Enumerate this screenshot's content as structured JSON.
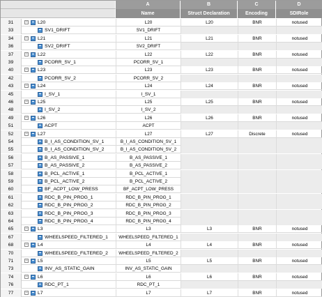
{
  "columns": {
    "letters": [
      "A",
      "B",
      "C",
      "D"
    ],
    "names": [
      "Name",
      "Struct Declaration",
      "Encoding",
      "SDIRole"
    ]
  },
  "rows": [
    {
      "num": "31",
      "label": "L20",
      "level": 0,
      "a": "L20",
      "b": "L20",
      "c": "BNR",
      "d": "notused"
    },
    {
      "num": "33",
      "label": "SV1_DRIFT",
      "level": 1,
      "a": "SV1_DRIFT",
      "b": "",
      "c": "",
      "d": ""
    },
    {
      "num": "34",
      "label": "L21",
      "level": 0,
      "a": "L21",
      "b": "L21",
      "c": "BNR",
      "d": "notused"
    },
    {
      "num": "36",
      "label": "SV2_DRIFT",
      "level": 1,
      "a": "SV2_DRIFT",
      "b": "",
      "c": "",
      "d": ""
    },
    {
      "num": "37",
      "label": "L22",
      "level": 0,
      "a": "L22",
      "b": "L22",
      "c": "BNR",
      "d": "notused"
    },
    {
      "num": "39",
      "label": "PCORR_SV_1",
      "level": 1,
      "a": "PCORR_SV_1",
      "b": "",
      "c": "",
      "d": ""
    },
    {
      "num": "40",
      "label": "L23",
      "level": 0,
      "a": "L23",
      "b": "L23",
      "c": "BNR",
      "d": "notused"
    },
    {
      "num": "42",
      "label": "PCORR_SV_2",
      "level": 1,
      "a": "PCORR_SV_2",
      "b": "",
      "c": "",
      "d": ""
    },
    {
      "num": "43",
      "label": "L24",
      "level": 0,
      "a": "L24",
      "b": "L24",
      "c": "BNR",
      "d": "notused"
    },
    {
      "num": "45",
      "label": "I_SV_1",
      "level": 1,
      "a": "I_SV_1",
      "b": "",
      "c": "",
      "d": ""
    },
    {
      "num": "46",
      "label": "L25",
      "level": 0,
      "a": "L25",
      "b": "L25",
      "c": "BNR",
      "d": "notused"
    },
    {
      "num": "48",
      "label": "I_SV_2",
      "level": 1,
      "a": "I_SV_2",
      "b": "",
      "c": "",
      "d": ""
    },
    {
      "num": "49",
      "label": "L26",
      "level": 0,
      "a": "L26",
      "b": "L26",
      "c": "BNR",
      "d": "notused"
    },
    {
      "num": "51",
      "label": "ACPT",
      "level": 1,
      "a": "ACPT",
      "b": "",
      "c": "",
      "d": ""
    },
    {
      "num": "52",
      "label": "L27",
      "level": 0,
      "a": "L27",
      "b": "L27",
      "c": "Discrete",
      "d": "notused"
    },
    {
      "num": "54",
      "label": "B_I_AS_CONDITION_SV_1",
      "level": 1,
      "a": "B_I_AS_CONDITION_SV_1",
      "b": "",
      "c": "",
      "d": ""
    },
    {
      "num": "55",
      "label": "B_I_AS_CONDITION_SV_2",
      "level": 1,
      "a": "B_I_AS_CONDITION_SV_2",
      "b": "",
      "c": "",
      "d": ""
    },
    {
      "num": "56",
      "label": "B_AS_PASSIVE_1",
      "level": 1,
      "a": "B_AS_PASSIVE_1",
      "b": "",
      "c": "",
      "d": ""
    },
    {
      "num": "57",
      "label": "B_AS_PASSIVE_2",
      "level": 1,
      "a": "B_AS_PASSIVE_2",
      "b": "",
      "c": "",
      "d": ""
    },
    {
      "num": "58",
      "label": "B_PCL_ACTIVE_1",
      "level": 1,
      "a": "B_PCL_ACTIVE_1",
      "b": "",
      "c": "",
      "d": ""
    },
    {
      "num": "59",
      "label": "B_PCL_ACTIVE_2",
      "level": 1,
      "a": "B_PCL_ACTIVE_2",
      "b": "",
      "c": "",
      "d": ""
    },
    {
      "num": "60",
      "label": "BF_ACPT_LOW_PRESS",
      "level": 1,
      "a": "BF_ACPT_LOW_PRESS",
      "b": "",
      "c": "",
      "d": ""
    },
    {
      "num": "61",
      "label": "RDC_B_PIN_PROG_1",
      "level": 1,
      "a": "RDC_B_PIN_PROG_1",
      "b": "",
      "c": "",
      "d": ""
    },
    {
      "num": "62",
      "label": "RDC_B_PIN_PROG_2",
      "level": 1,
      "a": "RDC_B_PIN_PROG_2",
      "b": "",
      "c": "",
      "d": ""
    },
    {
      "num": "63",
      "label": "RDC_B_PIN_PROG_3",
      "level": 1,
      "a": "RDC_B_PIN_PROG_3",
      "b": "",
      "c": "",
      "d": ""
    },
    {
      "num": "64",
      "label": "RDC_B_PIN_PROG_4",
      "level": 1,
      "a": "RDC_B_PIN_PROG_4",
      "b": "",
      "c": "",
      "d": ""
    },
    {
      "num": "65",
      "label": "L3",
      "level": 0,
      "a": "L3",
      "b": "L3",
      "c": "BNR",
      "d": "notused"
    },
    {
      "num": "67",
      "label": "WHEELSPEED_FILTERED_1",
      "level": 1,
      "a": "WHEELSPEED_FILTERED_1",
      "b": "",
      "c": "",
      "d": ""
    },
    {
      "num": "68",
      "label": "L4",
      "level": 0,
      "a": "L4",
      "b": "L4",
      "c": "BNR",
      "d": "notused"
    },
    {
      "num": "70",
      "label": "WHEELSPEED_FILTERED_2",
      "level": 1,
      "a": "WHEELSPEED_FILTERED_2",
      "b": "",
      "c": "",
      "d": ""
    },
    {
      "num": "71",
      "label": "L5",
      "level": 0,
      "a": "L5",
      "b": "L5",
      "c": "BNR",
      "d": "notused"
    },
    {
      "num": "73",
      "label": "INV_AS_STATIC_GAIN",
      "level": 1,
      "a": "INV_AS_STATIC_GAIN",
      "b": "",
      "c": "",
      "d": ""
    },
    {
      "num": "74",
      "label": "L6",
      "level": 0,
      "a": "L6",
      "b": "L6",
      "c": "BNR",
      "d": "notused"
    },
    {
      "num": "76",
      "label": "RDC_PT_1",
      "level": 1,
      "a": "RDC_PT_1",
      "b": "",
      "c": "",
      "d": ""
    },
    {
      "num": "77",
      "label": "L7",
      "level": 0,
      "a": "L7",
      "b": "L7",
      "c": "BNR",
      "d": "notused"
    }
  ]
}
